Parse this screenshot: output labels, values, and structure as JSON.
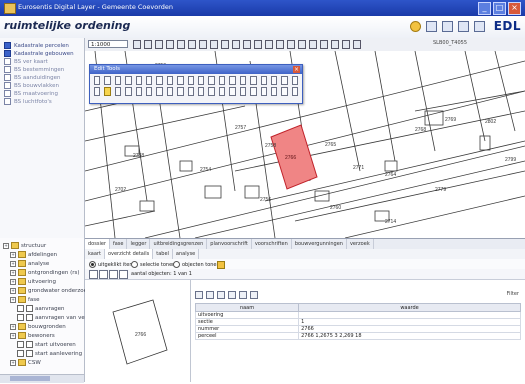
{
  "window": {
    "title": "Eurosentis Digital Layer - Gemeente Coevorden"
  },
  "header": {
    "app_title": "ruimtelijke ordening",
    "brand": "EDL"
  },
  "sidebar": {
    "items": [
      {
        "label": "Kadastrale percelen",
        "active": true
      },
      {
        "label": "Kadastrale gebouwen",
        "active": true
      },
      {
        "label": "BS ver kaart",
        "active": false
      },
      {
        "label": "BS bestemmingen",
        "active": false
      },
      {
        "label": "BS aanduidingen",
        "active": false
      },
      {
        "label": "BS bouwvlakken",
        "active": false
      },
      {
        "label": "BS maatvoering",
        "active": false
      },
      {
        "label": "BS luchtfoto's",
        "active": false
      }
    ]
  },
  "map_toolbar": {
    "scale": "1:1000",
    "parcel_id": "SLB00_T4055"
  },
  "edit_tools": {
    "title": "Edit Tools"
  },
  "tree": {
    "items": [
      {
        "label": "structuur",
        "indent": 0
      },
      {
        "label": "afdelingen",
        "indent": 1
      },
      {
        "label": "analyse",
        "indent": 1
      },
      {
        "label": "ontgrondingen (rs)",
        "indent": 1
      },
      {
        "label": "uitvoering",
        "indent": 1
      },
      {
        "label": "grondwater onderzoek",
        "indent": 1
      },
      {
        "label": "fase",
        "indent": 1
      },
      {
        "label": "aanvragen",
        "indent": 2
      },
      {
        "label": "aanvragen van veel",
        "indent": 2
      },
      {
        "label": "bouwgronden",
        "indent": 1
      },
      {
        "label": "bewoners",
        "indent": 1
      },
      {
        "label": "start uitvoeren",
        "indent": 2
      },
      {
        "label": "start aanlevering",
        "indent": 2
      },
      {
        "label": "CSW",
        "indent": 1
      }
    ]
  },
  "info_panel": {
    "tabs": [
      "dossier",
      "fase",
      "legger",
      "uitbreidingsgrenzen",
      "planvoorschrift",
      "voorschriften",
      "bouwvergunningen",
      "verzoek"
    ],
    "sub_tabs": [
      "kaart",
      "overzicht details",
      "tabel",
      "analyse"
    ],
    "options": [
      {
        "label": "uitgeklikt item",
        "selected": true
      },
      {
        "label": "selectie tonen",
        "selected": false
      },
      {
        "label": "objecten tonen",
        "selected": false
      }
    ],
    "nav_label": "aantal objecten: 1 van 1"
  },
  "preview": {
    "parcel_label": "2766"
  },
  "attributes": {
    "filter_label": "Filter",
    "columns": [
      "naam",
      "waarde"
    ],
    "rows": [
      {
        "name": "uitvoering",
        "value": ""
      },
      {
        "name": "sectie",
        "value": "1"
      },
      {
        "name": "nummer",
        "value": "2766"
      },
      {
        "name": "perceel",
        "value": "2766 1,2675 3 2,269 18"
      }
    ]
  },
  "map": {
    "highlight_label": "2766",
    "labels": [
      "2768",
      "2759",
      "2707",
      "2757",
      "2738",
      "2758",
      "2765",
      "2771",
      "2764",
      "2768",
      "2769",
      "2802",
      "2702",
      "2754",
      "2756",
      "2760",
      "2714",
      "2779",
      "2799"
    ]
  },
  "colors": {
    "title_bar": "#2e55c9",
    "highlight_parcel": "#f08585",
    "highlight_stroke": "#c0222a",
    "brand": "#0d2c86"
  }
}
